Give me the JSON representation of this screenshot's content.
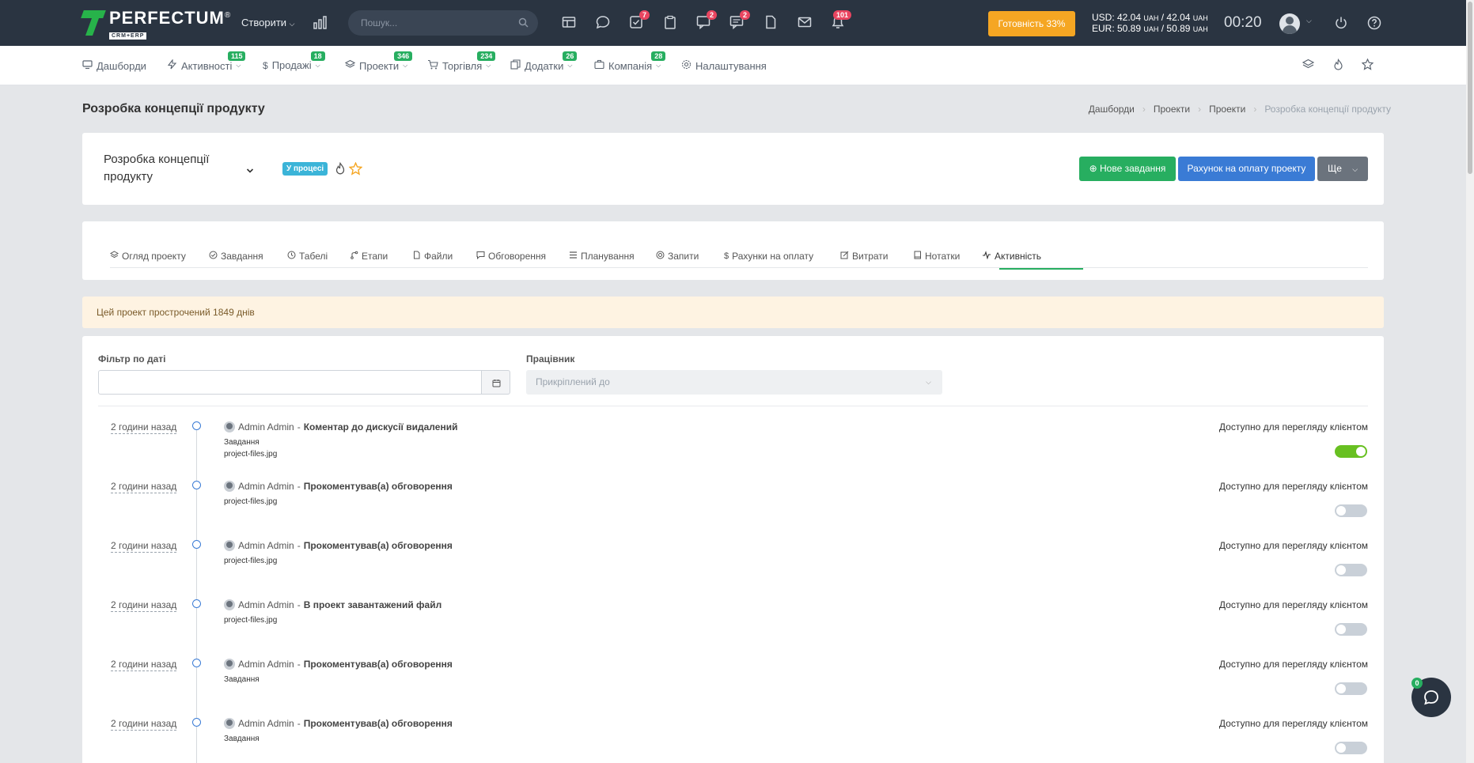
{
  "topbar": {
    "logo_title": "PERFECTUM",
    "logo_sub": "CRM+ERP",
    "create_label": "Створити",
    "search_placeholder": "Пошук...",
    "badges": {
      "tasks": "7",
      "chat": "2",
      "messages": "2",
      "notifications": "101"
    },
    "readiness_label": "Готовність 33%",
    "currency_usd": "USD: 42.04",
    "currency_usd_unit": "UAH",
    "currency_usd_sep": "/ 42.04",
    "currency_eur": "EUR: 50.89",
    "currency_eur_unit": "UAH",
    "currency_eur_sep": "/ 50.89",
    "clock": "00:20"
  },
  "nav": {
    "items": [
      {
        "label": "Дашборди",
        "badge": ""
      },
      {
        "label": "Активності",
        "badge": "115"
      },
      {
        "label": "Продажі",
        "badge": "18"
      },
      {
        "label": "Проекти",
        "badge": "346"
      },
      {
        "label": "Торгівля",
        "badge": "234"
      },
      {
        "label": "Додатки",
        "badge": "26"
      },
      {
        "label": "Компанія",
        "badge": "28"
      },
      {
        "label": "Налаштування",
        "badge": ""
      }
    ]
  },
  "page": {
    "title": "Розробка концепції продукту",
    "breadcrumb": [
      "Дашборди",
      "Проекти",
      "Проекти",
      "Розробка концепції продукту"
    ]
  },
  "project": {
    "name": "Розробка концепції продукту",
    "status": "У процесі",
    "btn_new_task": "Нове завдання",
    "btn_invoice": "Рахунок на оплату проекту",
    "btn_more": "Ще"
  },
  "tabs": [
    "Огляд проекту",
    "Завдання",
    "Табелі",
    "Етапи",
    "Файли",
    "Обговорення",
    "Планування",
    "Запити",
    "Рахунки на оплату",
    "Витрати",
    "Нотатки",
    "Активність"
  ],
  "alert": "Цей проект прострочений 1849 днів",
  "filters": {
    "date_label": "Фільтр по даті",
    "employee_label": "Працівник",
    "employee_placeholder": "Прикріплений до"
  },
  "activity": {
    "user": "Admin Admin",
    "visible_label": "Доступно для перегляду клієнтом",
    "rows": [
      {
        "time": "2 години назад",
        "action": "Коментар до дискусії видалений",
        "sub1": "Завдання",
        "sub2": "project-files.jpg",
        "visible": true
      },
      {
        "time": "2 години назад",
        "action": "Прокоментував(а) обговорення",
        "sub1": "project-files.jpg",
        "sub2": "",
        "visible": false
      },
      {
        "time": "2 години назад",
        "action": "Прокоментував(а) обговорення",
        "sub1": "project-files.jpg",
        "sub2": "",
        "visible": false
      },
      {
        "time": "2 години назад",
        "action": "В проект завантажений файл",
        "sub1": "project-files.jpg",
        "sub2": "",
        "visible": false
      },
      {
        "time": "2 години назад",
        "action": "Прокоментував(а) обговорення",
        "sub1": "Завдання",
        "sub2": "",
        "visible": false
      },
      {
        "time": "2 години назад",
        "action": "Прокоментував(а) обговорення",
        "sub1": "Завдання",
        "sub2": "",
        "visible": false
      }
    ]
  },
  "chat_badge": "0"
}
